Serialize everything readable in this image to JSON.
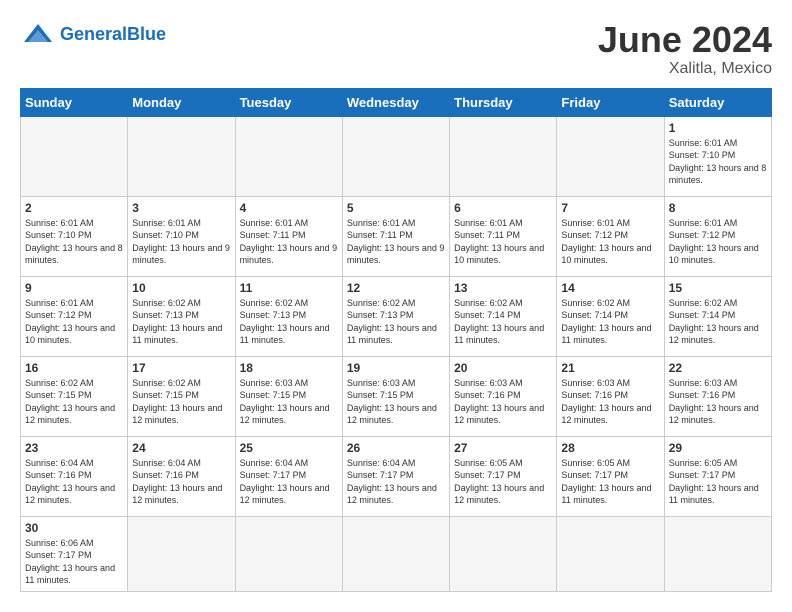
{
  "header": {
    "logo_general": "General",
    "logo_blue": "Blue",
    "month": "June 2024",
    "location": "Xalitla, Mexico"
  },
  "weekdays": [
    "Sunday",
    "Monday",
    "Tuesday",
    "Wednesday",
    "Thursday",
    "Friday",
    "Saturday"
  ],
  "days": {
    "d1": {
      "num": "1",
      "sunrise": "6:01 AM",
      "sunset": "7:10 PM",
      "daylight": "13 hours and 8 minutes."
    },
    "d2": {
      "num": "2",
      "sunrise": "6:01 AM",
      "sunset": "7:10 PM",
      "daylight": "13 hours and 8 minutes."
    },
    "d3": {
      "num": "3",
      "sunrise": "6:01 AM",
      "sunset": "7:10 PM",
      "daylight": "13 hours and 9 minutes."
    },
    "d4": {
      "num": "4",
      "sunrise": "6:01 AM",
      "sunset": "7:11 PM",
      "daylight": "13 hours and 9 minutes."
    },
    "d5": {
      "num": "5",
      "sunrise": "6:01 AM",
      "sunset": "7:11 PM",
      "daylight": "13 hours and 9 minutes."
    },
    "d6": {
      "num": "6",
      "sunrise": "6:01 AM",
      "sunset": "7:11 PM",
      "daylight": "13 hours and 10 minutes."
    },
    "d7": {
      "num": "7",
      "sunrise": "6:01 AM",
      "sunset": "7:12 PM",
      "daylight": "13 hours and 10 minutes."
    },
    "d8": {
      "num": "8",
      "sunrise": "6:01 AM",
      "sunset": "7:12 PM",
      "daylight": "13 hours and 10 minutes."
    },
    "d9": {
      "num": "9",
      "sunrise": "6:01 AM",
      "sunset": "7:12 PM",
      "daylight": "13 hours and 10 minutes."
    },
    "d10": {
      "num": "10",
      "sunrise": "6:02 AM",
      "sunset": "7:13 PM",
      "daylight": "13 hours and 11 minutes."
    },
    "d11": {
      "num": "11",
      "sunrise": "6:02 AM",
      "sunset": "7:13 PM",
      "daylight": "13 hours and 11 minutes."
    },
    "d12": {
      "num": "12",
      "sunrise": "6:02 AM",
      "sunset": "7:13 PM",
      "daylight": "13 hours and 11 minutes."
    },
    "d13": {
      "num": "13",
      "sunrise": "6:02 AM",
      "sunset": "7:14 PM",
      "daylight": "13 hours and 11 minutes."
    },
    "d14": {
      "num": "14",
      "sunrise": "6:02 AM",
      "sunset": "7:14 PM",
      "daylight": "13 hours and 11 minutes."
    },
    "d15": {
      "num": "15",
      "sunrise": "6:02 AM",
      "sunset": "7:14 PM",
      "daylight": "13 hours and 12 minutes."
    },
    "d16": {
      "num": "16",
      "sunrise": "6:02 AM",
      "sunset": "7:15 PM",
      "daylight": "13 hours and 12 minutes."
    },
    "d17": {
      "num": "17",
      "sunrise": "6:02 AM",
      "sunset": "7:15 PM",
      "daylight": "13 hours and 12 minutes."
    },
    "d18": {
      "num": "18",
      "sunrise": "6:03 AM",
      "sunset": "7:15 PM",
      "daylight": "13 hours and 12 minutes."
    },
    "d19": {
      "num": "19",
      "sunrise": "6:03 AM",
      "sunset": "7:15 PM",
      "daylight": "13 hours and 12 minutes."
    },
    "d20": {
      "num": "20",
      "sunrise": "6:03 AM",
      "sunset": "7:16 PM",
      "daylight": "13 hours and 12 minutes."
    },
    "d21": {
      "num": "21",
      "sunrise": "6:03 AM",
      "sunset": "7:16 PM",
      "daylight": "13 hours and 12 minutes."
    },
    "d22": {
      "num": "22",
      "sunrise": "6:03 AM",
      "sunset": "7:16 PM",
      "daylight": "13 hours and 12 minutes."
    },
    "d23": {
      "num": "23",
      "sunrise": "6:04 AM",
      "sunset": "7:16 PM",
      "daylight": "13 hours and 12 minutes."
    },
    "d24": {
      "num": "24",
      "sunrise": "6:04 AM",
      "sunset": "7:16 PM",
      "daylight": "13 hours and 12 minutes."
    },
    "d25": {
      "num": "25",
      "sunrise": "6:04 AM",
      "sunset": "7:17 PM",
      "daylight": "13 hours and 12 minutes."
    },
    "d26": {
      "num": "26",
      "sunrise": "6:04 AM",
      "sunset": "7:17 PM",
      "daylight": "13 hours and 12 minutes."
    },
    "d27": {
      "num": "27",
      "sunrise": "6:05 AM",
      "sunset": "7:17 PM",
      "daylight": "13 hours and 12 minutes."
    },
    "d28": {
      "num": "28",
      "sunrise": "6:05 AM",
      "sunset": "7:17 PM",
      "daylight": "13 hours and 11 minutes."
    },
    "d29": {
      "num": "29",
      "sunrise": "6:05 AM",
      "sunset": "7:17 PM",
      "daylight": "13 hours and 11 minutes."
    },
    "d30": {
      "num": "30",
      "sunrise": "6:06 AM",
      "sunset": "7:17 PM",
      "daylight": "13 hours and 11 minutes."
    }
  }
}
